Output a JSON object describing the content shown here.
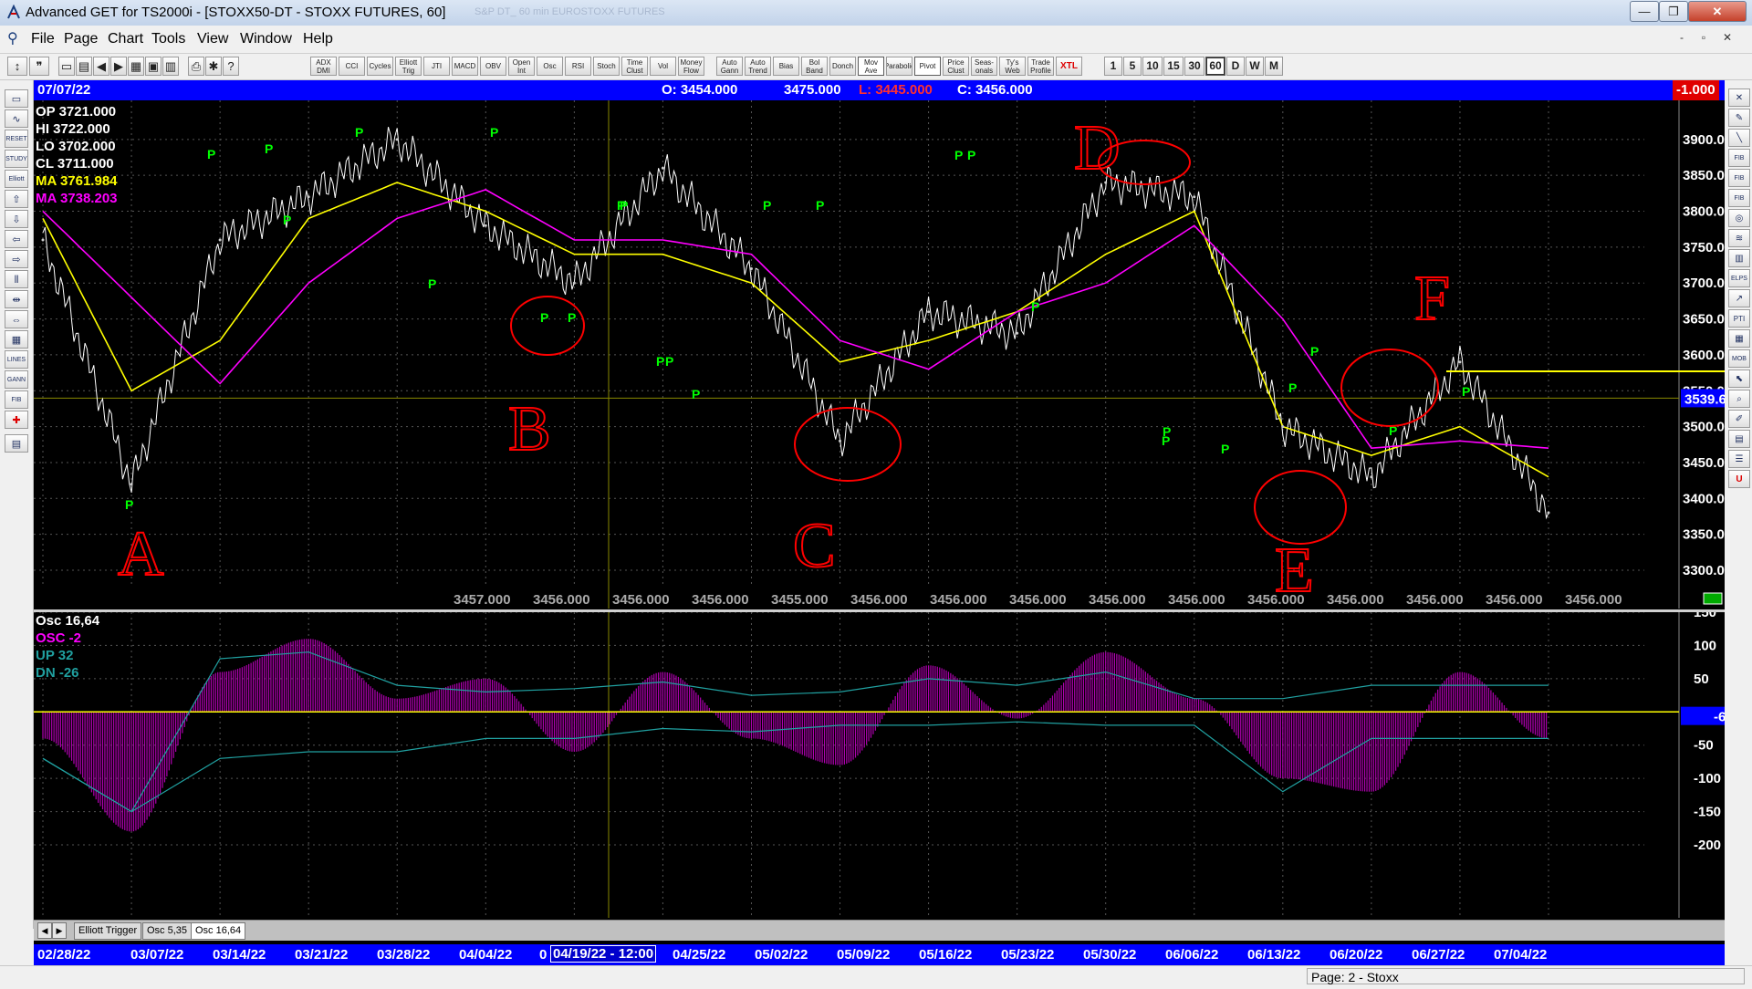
{
  "window": {
    "title": "Advanced GET for TS2000i - [STOXX50-DT - STOXX FUTURES, 60]",
    "faded_title": "S&P DT_ 60 min   EUROSTOXX FUTURES",
    "buttons": {
      "minimize": "—",
      "restore": "❐",
      "close": "✕"
    },
    "mdi_buttons": {
      "minimize": "-",
      "restore": "▫",
      "close": "✕"
    }
  },
  "menu": [
    "File",
    "Page",
    "Chart",
    "Tools",
    "View",
    "Window",
    "Help"
  ],
  "toolbar": {
    "studies": [
      "ADX DMI",
      "CCI",
      "Cycles",
      "Elliott Trig",
      "JTI",
      "MACD",
      "OBV",
      "Open Int",
      "Osc",
      "RSI",
      "Stoch",
      "Time Clust",
      "Vol",
      "Money Flow",
      "Auto Gann",
      "Auto Trend",
      "Bias",
      "Bol Band",
      "Donch",
      "Mov Ave",
      "Parabolic",
      "Pivot",
      "Price Clust",
      "Seas-onals",
      "Ty's Web",
      "Trade Profile",
      "XTL"
    ],
    "timeframes": [
      "1",
      "5",
      "10",
      "15",
      "30",
      "60",
      "D",
      "W",
      "M"
    ],
    "active_timeframe": "60"
  },
  "info_bar": {
    "date": "07/07/22",
    "open": "O: 3454.000",
    "high": "3475.000",
    "low": "L: 3445.000",
    "close": "C: 3456.000",
    "change": "-1.000"
  },
  "price_legend": {
    "op": "OP 3721.000",
    "hi": "HI  3722.000",
    "lo": "LO  3702.000",
    "cl": "CL  3711.000",
    "ma1": "MA  3761.984",
    "ma2": "MA  3738.203"
  },
  "price_axis": {
    "ticks": [
      "3900.000",
      "3850.000",
      "3800.000",
      "3750.000",
      "3700.000",
      "3650.000",
      "3600.000",
      "3550.000",
      "3500.000",
      "3450.000",
      "3400.000",
      "3350.000",
      "3300.000"
    ],
    "current": "3539.670"
  },
  "bottom_values": [
    "3457.000",
    "3456.000",
    "3456.000",
    "3456.000",
    "3455.000",
    "3456.000",
    "3456.000",
    "3456.000",
    "3456.000",
    "3456.000",
    "3456.000",
    "3456.000",
    "3456.000",
    "3456.000",
    "3456.000"
  ],
  "osc_legend": {
    "title": "Osc 16,64",
    "osc": "OSC -2",
    "up": "UP   32",
    "dn": "DN  -26"
  },
  "osc_axis": {
    "ticks": [
      "150",
      "100",
      "50",
      "-50",
      "-100",
      "-150",
      "-200"
    ],
    "current": "-6"
  },
  "tabs": [
    "Elliott Trigger",
    "Osc 5,35",
    "Osc 16,64"
  ],
  "active_tab": "Osc 16,64",
  "dates": [
    "02/28/22",
    "03/07/22",
    "03/14/22",
    "03/21/22",
    "03/28/22",
    "04/04/22",
    "04/19/22 - 12:00",
    "04/25/22",
    "05/02/22",
    "05/09/22",
    "05/16/22",
    "05/23/22",
    "05/30/22",
    "06/06/22",
    "06/13/22",
    "06/20/22",
    "06/27/22",
    "07/04/22"
  ],
  "date_prefix": "0",
  "annotations": {
    "wave_letters": [
      "A",
      "B",
      "C",
      "D",
      "E",
      "F"
    ],
    "pivot_label": "P"
  },
  "status": {
    "page": "Page: 2 - Stoxx"
  },
  "colors": {
    "info_bar": "#0000ff",
    "price_line": "#ffffff",
    "ma_fast": "#ffff00",
    "ma_slow": "#ff00ff",
    "osc_fill": "#b000b0",
    "up_line": "#20a0a0",
    "pivot": "#00ff00",
    "annotation": "#ff0000"
  },
  "chart_data": {
    "type": "line",
    "title": "STOXX50-DT - STOXX FUTURES, 60",
    "price_scale": [
      3300,
      3900
    ],
    "x": [
      "02/28/22",
      "03/07/22",
      "03/14/22",
      "03/21/22",
      "03/28/22",
      "04/04/22",
      "04/19/22",
      "04/25/22",
      "05/02/22",
      "05/09/22",
      "05/16/22",
      "05/23/22",
      "05/30/22",
      "06/06/22",
      "06/13/22",
      "06/20/22",
      "06/27/22",
      "07/04/22"
    ],
    "series": [
      {
        "name": "Price",
        "values": [
          3760,
          3420,
          3760,
          3820,
          3900,
          3780,
          3700,
          3860,
          3720,
          3480,
          3660,
          3630,
          3840,
          3820,
          3500,
          3430,
          3590,
          3380
        ]
      },
      {
        "name": "MA",
        "values": [
          3790,
          3550,
          3620,
          3790,
          3840,
          3800,
          3740,
          3740,
          3700,
          3590,
          3620,
          3660,
          3740,
          3800,
          3500,
          3460,
          3500,
          3430
        ]
      },
      {
        "name": "MA",
        "values": [
          3800,
          3680,
          3560,
          3700,
          3790,
          3830,
          3760,
          3760,
          3740,
          3620,
          3580,
          3660,
          3700,
          3780,
          3650,
          3470,
          3480,
          3470
        ]
      }
    ],
    "osc": {
      "name": "OSC",
      "scale": [
        -200,
        150
      ],
      "values": [
        -40,
        -180,
        60,
        110,
        20,
        50,
        -60,
        60,
        -40,
        -80,
        70,
        -10,
        90,
        20,
        -100,
        -120,
        60,
        -40
      ],
      "up": [
        -70,
        -150,
        80,
        90,
        40,
        30,
        35,
        45,
        25,
        30,
        50,
        40,
        60,
        20,
        20,
        40,
        40,
        40
      ],
      "dn": [
        -70,
        -150,
        -70,
        -60,
        -60,
        -40,
        -40,
        -25,
        -30,
        -20,
        -20,
        -15,
        -20,
        -20,
        -120,
        -40,
        -40,
        -40
      ]
    }
  }
}
